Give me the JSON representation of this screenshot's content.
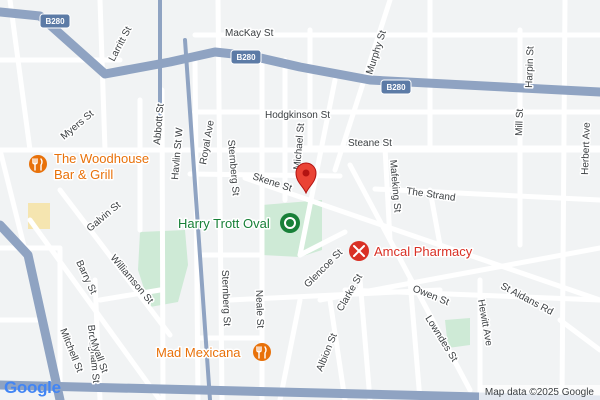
{
  "map": {
    "streets": [
      {
        "key": "mackay",
        "name": "MacKay St"
      },
      {
        "key": "murphy",
        "name": "Murphy St"
      },
      {
        "key": "laritt",
        "name": "Larritt St"
      },
      {
        "key": "myers",
        "name": "Myers St"
      },
      {
        "key": "abbott",
        "name": "Abbott St"
      },
      {
        "key": "havlin",
        "name": "Havlin St W"
      },
      {
        "key": "royal",
        "name": "Royal Ave"
      },
      {
        "key": "sternberg1",
        "name": "Sternberg St"
      },
      {
        "key": "hodgkinson",
        "name": "Hodgkinson St"
      },
      {
        "key": "michael",
        "name": "Michael St"
      },
      {
        "key": "steane",
        "name": "Steane St"
      },
      {
        "key": "mafeking",
        "name": "Mafeking St"
      },
      {
        "key": "skene",
        "name": "Skene St"
      },
      {
        "key": "strand",
        "name": "The Strand"
      },
      {
        "key": "galvin",
        "name": "Galvin St"
      },
      {
        "key": "williamson",
        "name": "Williamson St"
      },
      {
        "key": "barry",
        "name": "Barry St"
      },
      {
        "key": "sternberg2",
        "name": "Sternberg St"
      },
      {
        "key": "glencoe",
        "name": "Glencoe St"
      },
      {
        "key": "clarke",
        "name": "Clarke St"
      },
      {
        "key": "owen",
        "name": "Owen St"
      },
      {
        "key": "neale",
        "name": "Neale St"
      },
      {
        "key": "hewitt",
        "name": "Hewitt Ave"
      },
      {
        "key": "staidans",
        "name": "St Aidans Rd"
      },
      {
        "key": "lowndes",
        "name": "Lowndes St"
      },
      {
        "key": "brougham",
        "name": "Brougham St"
      },
      {
        "key": "myall",
        "name": "Myall St"
      },
      {
        "key": "mitchell",
        "name": "Mitchell St"
      },
      {
        "key": "albion",
        "name": "Albion St"
      },
      {
        "key": "harpin",
        "name": "Harpin St"
      },
      {
        "key": "mill",
        "name": "Mill St"
      },
      {
        "key": "herbert",
        "name": "Herbert Ave"
      }
    ],
    "shields": [
      {
        "key": "b280a",
        "label": "B280"
      },
      {
        "key": "b280b",
        "label": "B280"
      },
      {
        "key": "b280c",
        "label": "B280"
      }
    ],
    "pois": {
      "woodhouse_line1": "The Woodhouse",
      "woodhouse_line2": "Bar & Grill",
      "oval": "Harry Trott Oval",
      "pharmacy": "Amcal Pharmacy",
      "mexicana": "Mad Mexicana"
    },
    "icons": {
      "restaurant": "fork-knife-icon",
      "park": "park-icon",
      "pharmacy": "pharmacy-icon",
      "pin": "map-pin-icon"
    },
    "colors": {
      "road_major": "#8fa3c2",
      "road_minor": "#ffffff",
      "background": "#f1f3f4",
      "park": "#ceead6",
      "restaurant": "#e8710a",
      "park_poi": "#188038",
      "pharmacy": "#d93025",
      "pin": "#ea4335"
    }
  },
  "branding": {
    "logo_text": "Google",
    "attribution": "Map data ©2025 Google"
  }
}
